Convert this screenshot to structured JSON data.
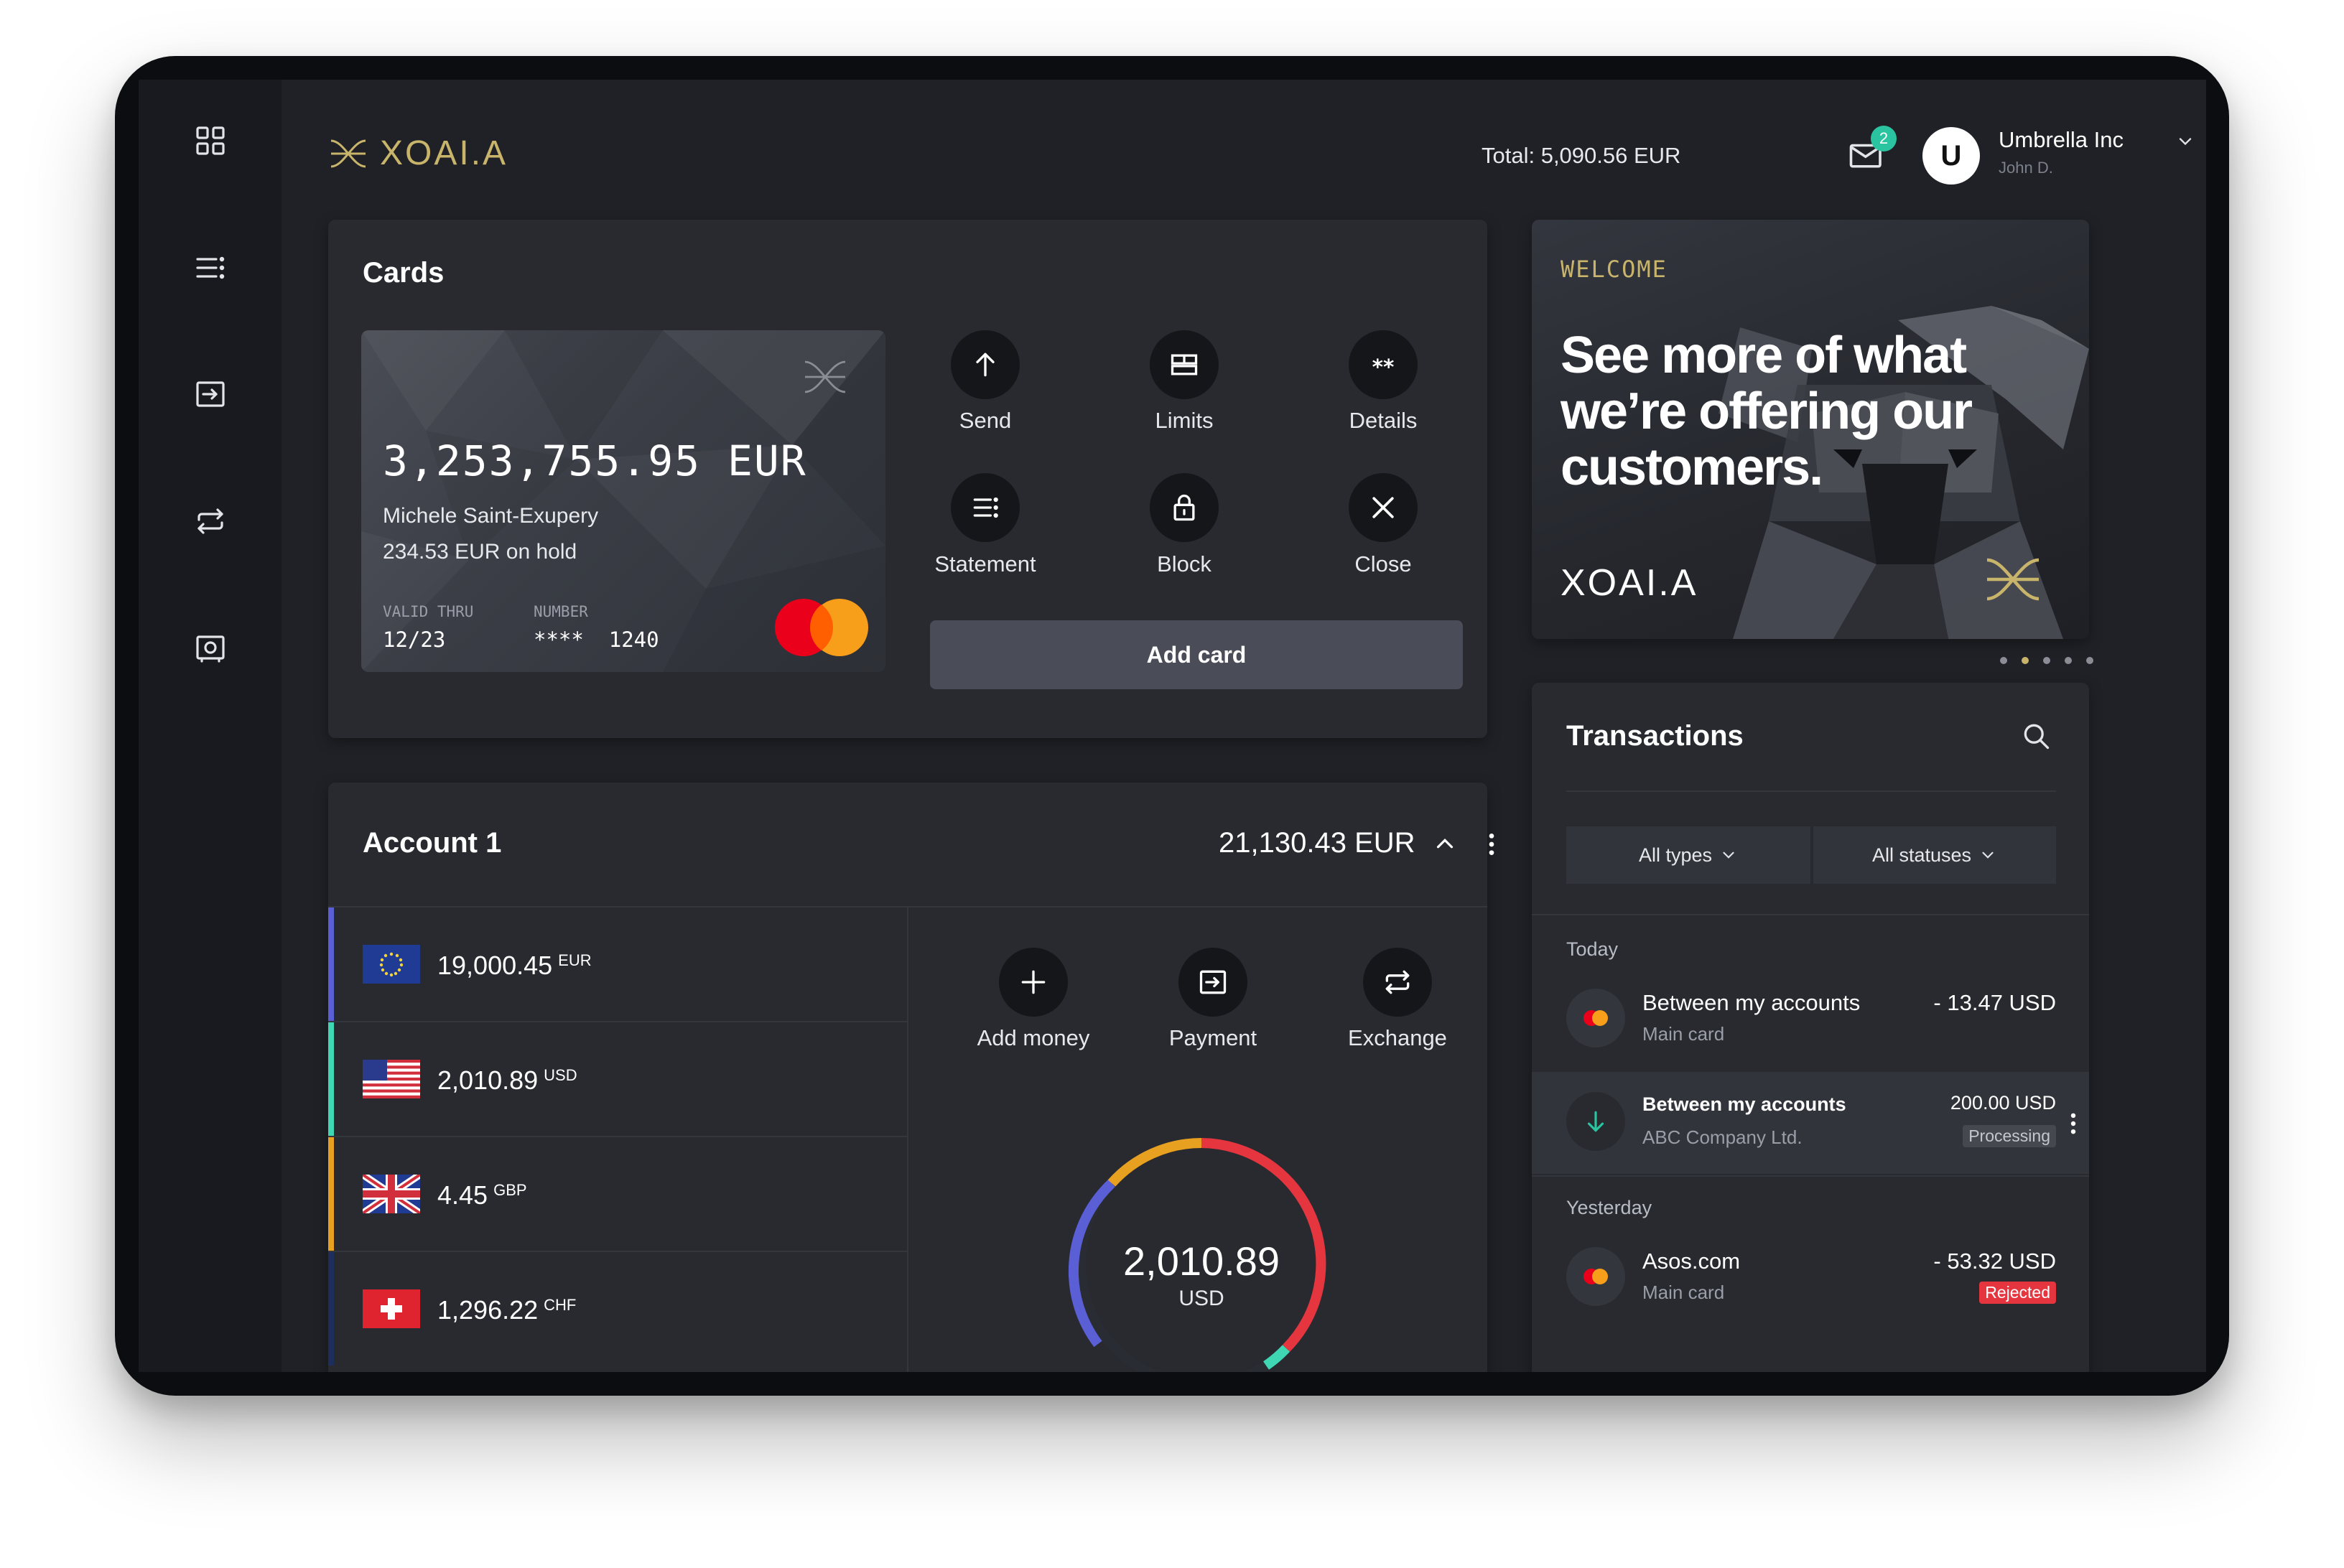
{
  "app": {
    "brand": "XOAI.A"
  },
  "header": {
    "total": "Total: 5,090.56 EUR",
    "mail_count": "2",
    "avatar_letter": "U",
    "company": "Umbrella Inc",
    "user": "John D."
  },
  "sidebar": {
    "items": [
      {
        "icon": "dashboard-grid-icon"
      },
      {
        "icon": "list-menu-icon"
      },
      {
        "icon": "payment-icon"
      },
      {
        "icon": "exchange-icon"
      },
      {
        "icon": "safe-icon"
      }
    ]
  },
  "cards": {
    "title": "Cards",
    "card": {
      "balance": "3,253,755.95 EUR",
      "holder": "Michele Saint-Exupery",
      "on_hold": "234.53 EUR on hold",
      "valid_label": "VALID THRU",
      "valid_value": "12/23",
      "number_label": "NUMBER",
      "number_value": "****  1240"
    },
    "actions": [
      {
        "label": "Send",
        "icon": "arrow-up-icon"
      },
      {
        "label": "Limits",
        "icon": "limits-icon"
      },
      {
        "label": "Details",
        "icon": "asterisks-icon"
      },
      {
        "label": "Statement",
        "icon": "statement-icon"
      },
      {
        "label": "Block",
        "icon": "lock-icon"
      },
      {
        "label": "Close",
        "icon": "close-icon"
      }
    ],
    "add_card": "Add card"
  },
  "account": {
    "title": "Account 1",
    "total": "21,130.43 EUR",
    "currencies": [
      {
        "amount": "19,000.45",
        "code": "EUR",
        "color": "#5a5fd6"
      },
      {
        "amount": "2,010.89",
        "code": "USD",
        "color": "#3fd6b4"
      },
      {
        "amount": "4.45",
        "code": "GBP",
        "color": "#e8a020"
      },
      {
        "amount": "1,296.22",
        "code": "CHF",
        "color": "#1d2e5c"
      }
    ],
    "actions": [
      {
        "label": "Add money",
        "icon": "plus-icon"
      },
      {
        "label": "Payment",
        "icon": "payment-icon"
      },
      {
        "label": "Exchange",
        "icon": "exchange-icon"
      }
    ],
    "donut": {
      "value": "2,010.89",
      "currency": "USD"
    }
  },
  "welcome": {
    "kicker": "WELCOME",
    "headline": "See more of what we’re offering our customers.",
    "brand": "XOAI.A",
    "dots": 5,
    "active_dot": 2
  },
  "transactions": {
    "title": "Transactions",
    "filters": {
      "types": "All types",
      "statuses": "All statuses"
    },
    "groups": [
      {
        "label": "Today",
        "items": [
          {
            "title": "Between my accounts",
            "sub": "Main card",
            "amount": "- 13.47 USD",
            "status": ""
          },
          {
            "title": "Between my accounts",
            "sub": "ABC Company Ltd.",
            "amount": "200.00 USD",
            "status": "Processing"
          }
        ]
      },
      {
        "label": "Yesterday",
        "items": [
          {
            "title": "Asos.com",
            "sub": "Main card",
            "amount": "- 53.32 USD",
            "status": "Rejected"
          }
        ]
      }
    ]
  },
  "colors": {
    "accent_gold": "#c8b46a",
    "teal": "#2bc4a0",
    "rejected": "#e5353f"
  }
}
